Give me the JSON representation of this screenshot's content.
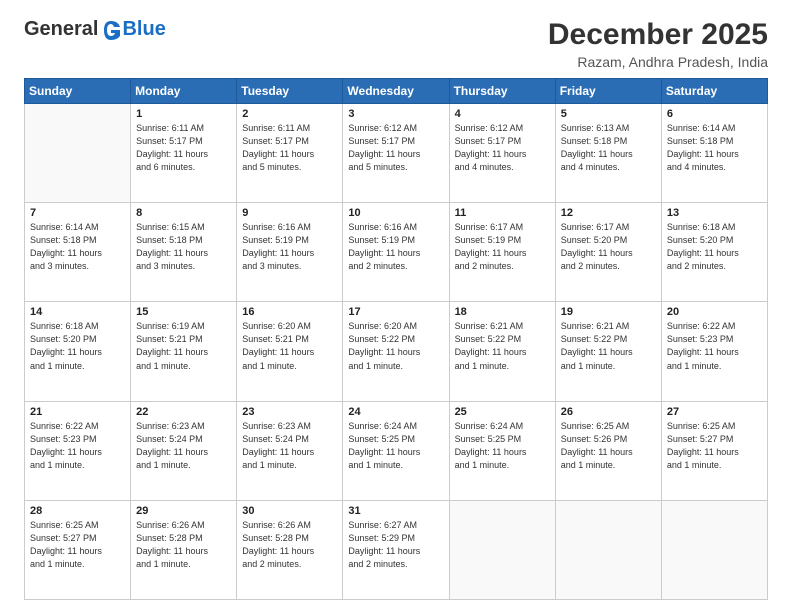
{
  "logo": {
    "general": "General",
    "blue": "Blue"
  },
  "title": "December 2025",
  "location": "Razam, Andhra Pradesh, India",
  "headers": [
    "Sunday",
    "Monday",
    "Tuesday",
    "Wednesday",
    "Thursday",
    "Friday",
    "Saturday"
  ],
  "weeks": [
    [
      {
        "day": "",
        "info": ""
      },
      {
        "day": "1",
        "info": "Sunrise: 6:11 AM\nSunset: 5:17 PM\nDaylight: 11 hours\nand 6 minutes."
      },
      {
        "day": "2",
        "info": "Sunrise: 6:11 AM\nSunset: 5:17 PM\nDaylight: 11 hours\nand 5 minutes."
      },
      {
        "day": "3",
        "info": "Sunrise: 6:12 AM\nSunset: 5:17 PM\nDaylight: 11 hours\nand 5 minutes."
      },
      {
        "day": "4",
        "info": "Sunrise: 6:12 AM\nSunset: 5:17 PM\nDaylight: 11 hours\nand 4 minutes."
      },
      {
        "day": "5",
        "info": "Sunrise: 6:13 AM\nSunset: 5:18 PM\nDaylight: 11 hours\nand 4 minutes."
      },
      {
        "day": "6",
        "info": "Sunrise: 6:14 AM\nSunset: 5:18 PM\nDaylight: 11 hours\nand 4 minutes."
      }
    ],
    [
      {
        "day": "7",
        "info": "Sunrise: 6:14 AM\nSunset: 5:18 PM\nDaylight: 11 hours\nand 3 minutes."
      },
      {
        "day": "8",
        "info": "Sunrise: 6:15 AM\nSunset: 5:18 PM\nDaylight: 11 hours\nand 3 minutes."
      },
      {
        "day": "9",
        "info": "Sunrise: 6:16 AM\nSunset: 5:19 PM\nDaylight: 11 hours\nand 3 minutes."
      },
      {
        "day": "10",
        "info": "Sunrise: 6:16 AM\nSunset: 5:19 PM\nDaylight: 11 hours\nand 2 minutes."
      },
      {
        "day": "11",
        "info": "Sunrise: 6:17 AM\nSunset: 5:19 PM\nDaylight: 11 hours\nand 2 minutes."
      },
      {
        "day": "12",
        "info": "Sunrise: 6:17 AM\nSunset: 5:20 PM\nDaylight: 11 hours\nand 2 minutes."
      },
      {
        "day": "13",
        "info": "Sunrise: 6:18 AM\nSunset: 5:20 PM\nDaylight: 11 hours\nand 2 minutes."
      }
    ],
    [
      {
        "day": "14",
        "info": "Sunrise: 6:18 AM\nSunset: 5:20 PM\nDaylight: 11 hours\nand 1 minute."
      },
      {
        "day": "15",
        "info": "Sunrise: 6:19 AM\nSunset: 5:21 PM\nDaylight: 11 hours\nand 1 minute."
      },
      {
        "day": "16",
        "info": "Sunrise: 6:20 AM\nSunset: 5:21 PM\nDaylight: 11 hours\nand 1 minute."
      },
      {
        "day": "17",
        "info": "Sunrise: 6:20 AM\nSunset: 5:22 PM\nDaylight: 11 hours\nand 1 minute."
      },
      {
        "day": "18",
        "info": "Sunrise: 6:21 AM\nSunset: 5:22 PM\nDaylight: 11 hours\nand 1 minute."
      },
      {
        "day": "19",
        "info": "Sunrise: 6:21 AM\nSunset: 5:22 PM\nDaylight: 11 hours\nand 1 minute."
      },
      {
        "day": "20",
        "info": "Sunrise: 6:22 AM\nSunset: 5:23 PM\nDaylight: 11 hours\nand 1 minute."
      }
    ],
    [
      {
        "day": "21",
        "info": "Sunrise: 6:22 AM\nSunset: 5:23 PM\nDaylight: 11 hours\nand 1 minute."
      },
      {
        "day": "22",
        "info": "Sunrise: 6:23 AM\nSunset: 5:24 PM\nDaylight: 11 hours\nand 1 minute."
      },
      {
        "day": "23",
        "info": "Sunrise: 6:23 AM\nSunset: 5:24 PM\nDaylight: 11 hours\nand 1 minute."
      },
      {
        "day": "24",
        "info": "Sunrise: 6:24 AM\nSunset: 5:25 PM\nDaylight: 11 hours\nand 1 minute."
      },
      {
        "day": "25",
        "info": "Sunrise: 6:24 AM\nSunset: 5:25 PM\nDaylight: 11 hours\nand 1 minute."
      },
      {
        "day": "26",
        "info": "Sunrise: 6:25 AM\nSunset: 5:26 PM\nDaylight: 11 hours\nand 1 minute."
      },
      {
        "day": "27",
        "info": "Sunrise: 6:25 AM\nSunset: 5:27 PM\nDaylight: 11 hours\nand 1 minute."
      }
    ],
    [
      {
        "day": "28",
        "info": "Sunrise: 6:25 AM\nSunset: 5:27 PM\nDaylight: 11 hours\nand 1 minute."
      },
      {
        "day": "29",
        "info": "Sunrise: 6:26 AM\nSunset: 5:28 PM\nDaylight: 11 hours\nand 1 minute."
      },
      {
        "day": "30",
        "info": "Sunrise: 6:26 AM\nSunset: 5:28 PM\nDaylight: 11 hours\nand 2 minutes."
      },
      {
        "day": "31",
        "info": "Sunrise: 6:27 AM\nSunset: 5:29 PM\nDaylight: 11 hours\nand 2 minutes."
      },
      {
        "day": "",
        "info": ""
      },
      {
        "day": "",
        "info": ""
      },
      {
        "day": "",
        "info": ""
      }
    ]
  ]
}
